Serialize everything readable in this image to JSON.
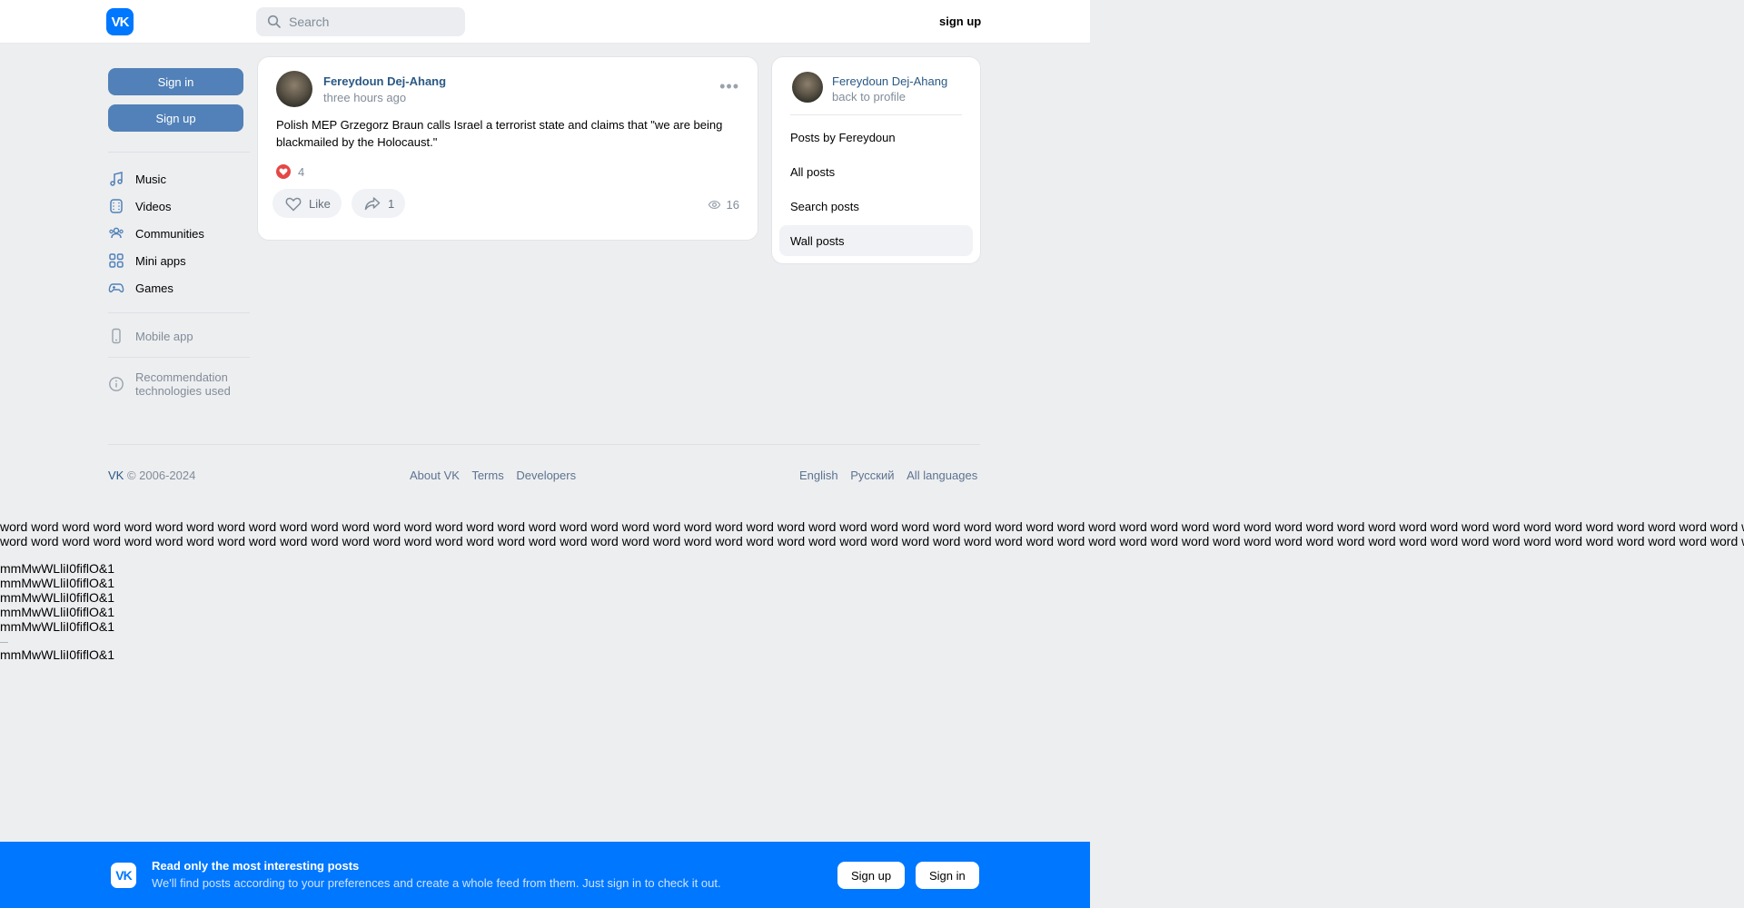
{
  "header": {
    "logo_text": "VK",
    "search_placeholder": "Search",
    "signup_label": "sign up"
  },
  "left_nav": {
    "sign_in_label": "Sign in",
    "sign_up_label": "Sign up",
    "items": [
      {
        "label": "Music",
        "icon": "music-icon"
      },
      {
        "label": "Videos",
        "icon": "video-icon"
      },
      {
        "label": "Communities",
        "icon": "communities-icon"
      },
      {
        "label": "Mini apps",
        "icon": "mini-apps-icon"
      },
      {
        "label": "Games",
        "icon": "gamepad-icon"
      }
    ],
    "mobile_app_label": "Mobile app",
    "recommendation_label": "Recommendation technologies used"
  },
  "post": {
    "author": "Fereydoun Dej-Ahang",
    "time": "three hours ago",
    "text": "Polish MEP Grzegorz Braun calls Israel a terrorist state and claims that \"we are being blackmailed by the Holocaust.\"",
    "reaction_count": "4",
    "like_label": "Like",
    "share_count": "1",
    "views": "16"
  },
  "side_card": {
    "name": "Fereydoun Dej-Ahang",
    "back_label": "back to profile",
    "items": [
      {
        "label": "Posts by Fereydoun",
        "active": false
      },
      {
        "label": "All posts",
        "active": false
      },
      {
        "label": "Search posts",
        "active": false
      },
      {
        "label": "Wall posts",
        "active": true
      }
    ]
  },
  "footer": {
    "copyright_brand": "VK",
    "copyright_years": " © 2006-2024",
    "links": [
      "About VK",
      "Terms",
      "Developers"
    ],
    "languages": [
      "English",
      "Русский",
      "All languages"
    ]
  },
  "filler": {
    "word": "word",
    "word_count": 120,
    "glyph_line": "mmMwWLliI0fiflO&1"
  },
  "banner": {
    "logo_text": "VK",
    "title": "Read only the most interesting posts",
    "subtitle": "We'll find posts according to your preferences and create a whole feed from them. Just sign in to check it out.",
    "signup_label": "Sign up",
    "signin_label": "Sign in"
  },
  "colors": {
    "brand": "#0077ff",
    "button_blue": "#5181b8",
    "link": "#2a5885",
    "background": "#edeef0"
  }
}
